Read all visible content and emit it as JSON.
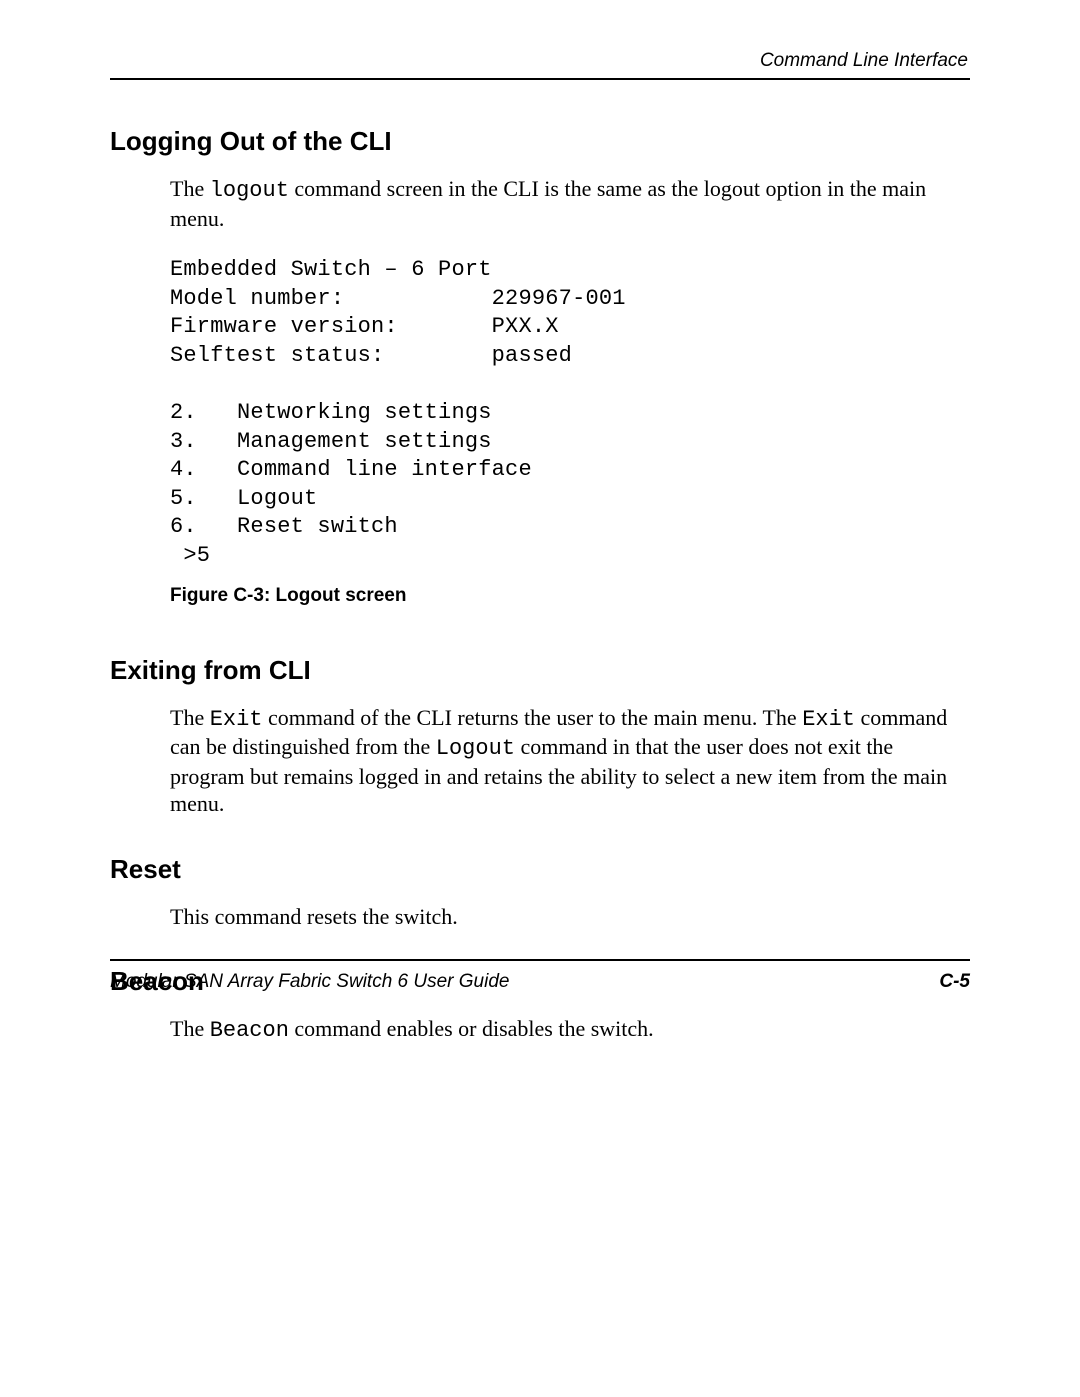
{
  "header": {
    "section_title": "Command Line Interface"
  },
  "sections": {
    "logging_out": {
      "heading": "Logging Out of the CLI",
      "para_pre": "The ",
      "para_cmd": "logout",
      "para_post": " command screen in the CLI is the same as the logout option in the main menu."
    },
    "terminal": {
      "line1": "Embedded Switch – 6 Port",
      "line2": "Model number:           229967-001",
      "line3": "Firmware version:       PXX.X",
      "line4": "Selftest status:        passed",
      "blank": "",
      "line5": "2.   Networking settings",
      "line6": "3.   Management settings",
      "line7": "4.   Command line interface",
      "line8": "5.   Logout",
      "line9": "6.   Reset switch",
      "line10": " >5"
    },
    "figure_caption": "Figure C-3:  Logout screen",
    "exiting": {
      "heading": "Exiting from CLI",
      "p1": "The ",
      "c1": "Exit",
      "p2": " command of the CLI returns the user to the main menu. The ",
      "c2": "Exit",
      "p3": " command can be distinguished from the ",
      "c3": "Logout",
      "p4": " command in that the user does not exit the program but remains logged in and retains the ability to select a new item from the main menu."
    },
    "reset": {
      "heading": "Reset",
      "para": "This command resets the switch."
    },
    "beacon": {
      "heading": "Beacon",
      "p1": "The ",
      "c1": "Beacon",
      "p2": " command enables or disables the switch."
    }
  },
  "footer": {
    "doc_title": "Modular SAN Array Fabric Switch 6 User Guide",
    "page_number": "C-5"
  }
}
